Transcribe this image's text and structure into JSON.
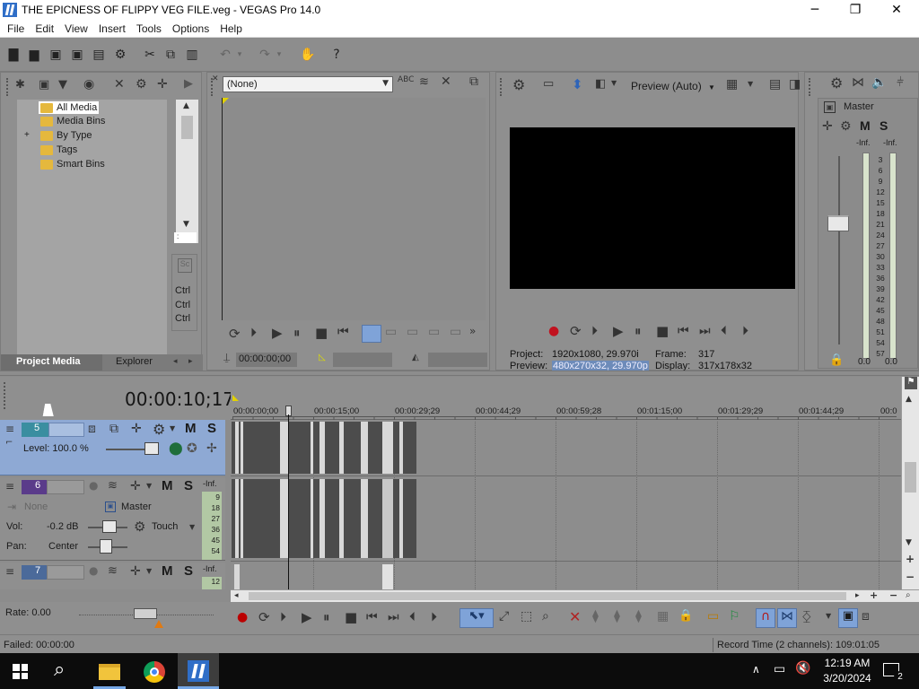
{
  "window": {
    "title": "THE EPICNESS OF FLIPPY VEG FILE.veg - VEGAS Pro 14.0",
    "controls": [
      "─",
      "❐",
      "✕"
    ]
  },
  "menu": [
    "File",
    "Edit",
    "View",
    "Insert",
    "Tools",
    "Options",
    "Help"
  ],
  "project_media": {
    "tree": [
      "All Media",
      "Media Bins",
      "By Type",
      "Tags",
      "Smart Bins"
    ],
    "expander": "+",
    "side_icon": "Sc",
    "ctrl_labels": [
      "Ctrl",
      "Ctrl",
      "Ctrl"
    ],
    "tabs": [
      "Project Media",
      "Explorer"
    ]
  },
  "trimmer": {
    "select_value": "(None)",
    "timecode": "00:00:00;00"
  },
  "preview": {
    "mode": "Preview (Auto)",
    "project_label": "Project:",
    "project_value": "1920x1080, 29.970i",
    "frame_label": "Frame:",
    "frame_value": "317",
    "preview_label": "Preview:",
    "preview_value": "480x270x32, 29.970p",
    "display_label": "Display:",
    "display_value": "317x178x32"
  },
  "master": {
    "label": "Master",
    "m": "M",
    "s": "S",
    "inf_left": "-Inf.",
    "inf_right": "-Inf.",
    "scale": [
      "3",
      "6",
      "9",
      "12",
      "15",
      "18",
      "21",
      "24",
      "27",
      "30",
      "33",
      "36",
      "39",
      "42",
      "45",
      "48",
      "51",
      "54",
      "57"
    ],
    "bottom_left": "0.0",
    "bottom_right": "0.0"
  },
  "timeline": {
    "cursor_time": "00:00:10;17",
    "ruler": [
      "00:00:00;00",
      "00:00:15;00",
      "00:00:29;29",
      "00:00:44;29",
      "00:00:59;28",
      "00:01:15;00",
      "00:01:29;29",
      "00:01:44;29",
      "00:0"
    ],
    "rate": "Rate: 0.00",
    "status_left": "Failed: 00:00:00",
    "status_right": "Record Time (2 channels): 109:01:05"
  },
  "tracks": [
    {
      "number": "5",
      "m": "M",
      "s": "S",
      "level_label": "Level: 100.0 %"
    },
    {
      "number": "6",
      "m": "M",
      "s": "S",
      "inf": "-Inf.",
      "meter": [
        "9",
        "18",
        "27",
        "36",
        "45",
        "54"
      ],
      "input": "None",
      "output": "Master",
      "vol_label": "Vol:",
      "vol_value": "-0.2 dB",
      "touch": "Touch",
      "pan_label": "Pan:",
      "pan_value": "Center"
    },
    {
      "number": "7",
      "m": "M",
      "s": "S",
      "inf": "-Inf.",
      "meter": [
        "12"
      ]
    }
  ],
  "taskbar": {
    "time": "12:19 AM",
    "date": "3/20/2024",
    "notifications": "2"
  },
  "colors": {
    "accent_blue": "#3b78d8",
    "track_selected": "#8ea9d4",
    "clip_dark": "#4c4c4c"
  }
}
